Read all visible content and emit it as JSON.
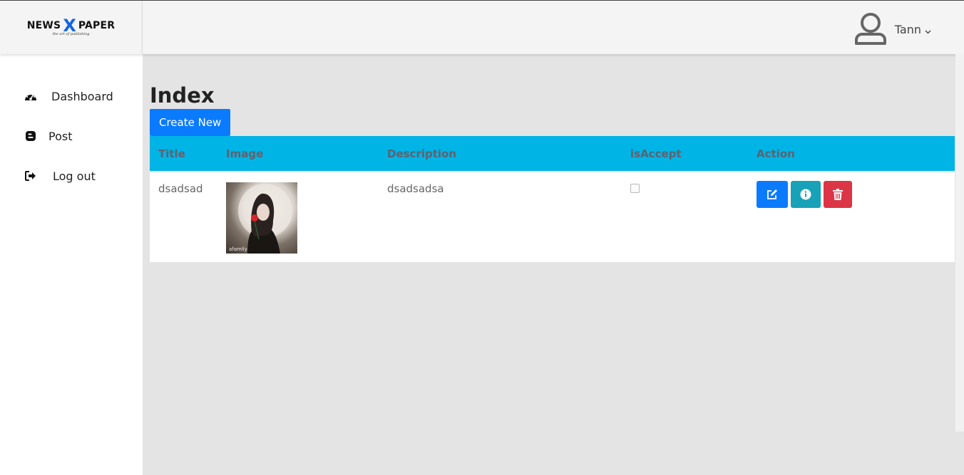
{
  "brand": {
    "left": "NEWS",
    "x": "X",
    "right": "PAPER",
    "tagline": "the art of publishing"
  },
  "colors": {
    "accent": "#0a7bff",
    "table_header": "#00b4e6",
    "info": "#17a2b8",
    "danger": "#dc3545"
  },
  "sidebar": {
    "items": [
      {
        "label": "Dashboard",
        "icon": "tachometer-icon"
      },
      {
        "label": "Post",
        "icon": "blogger-icon"
      },
      {
        "label": "Log out",
        "icon": "sign-out-icon"
      }
    ]
  },
  "header": {
    "user_name": "Tann",
    "avatar_icon": "user-icon"
  },
  "main": {
    "title": "Index",
    "create_label": "Create New",
    "table": {
      "columns": [
        "Title",
        "Image",
        "Description",
        "isAccept",
        "Action"
      ],
      "rows": [
        {
          "title": "dsadsad",
          "image_caption": "afamily",
          "description": "dsadsadsa",
          "is_accept": false
        }
      ]
    },
    "actions": [
      "edit-icon",
      "info-icon",
      "trash-icon"
    ]
  }
}
